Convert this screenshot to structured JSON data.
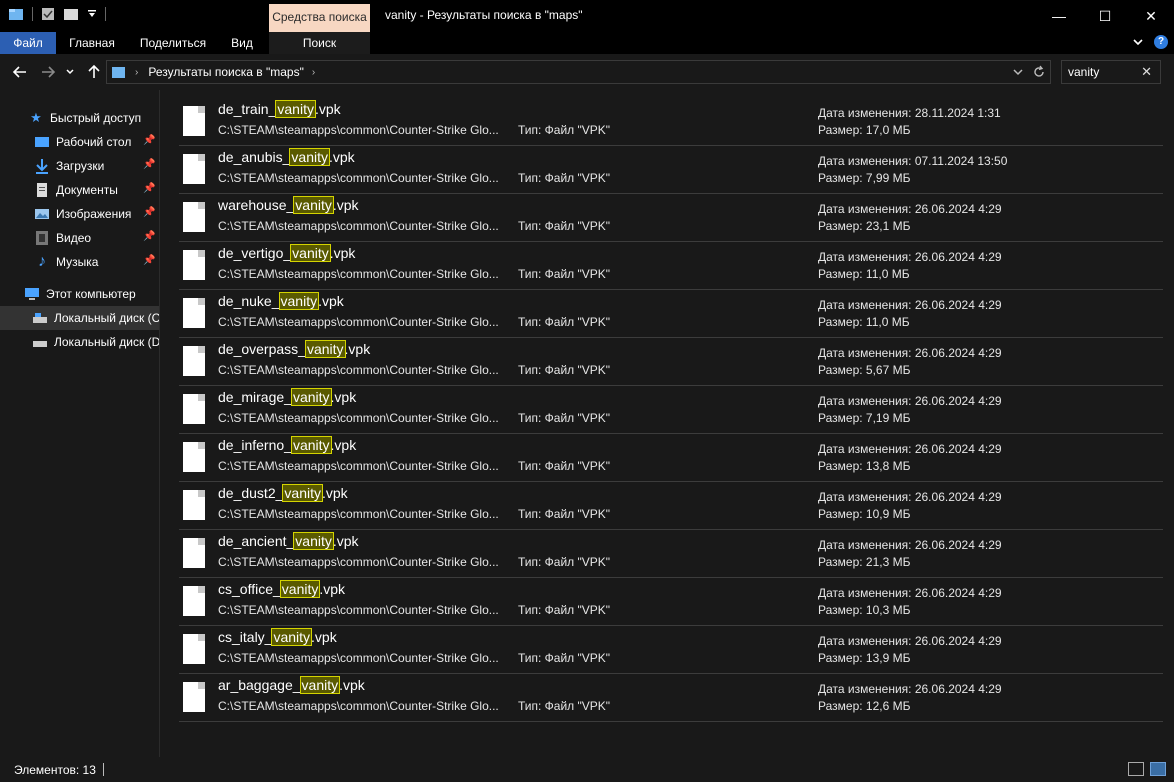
{
  "window": {
    "title": "vanity - Результаты поиска в \"maps\"",
    "tool_tab": "Средства поиска",
    "minimize_glyph": "—",
    "maximize_glyph": "☐",
    "close_glyph": "✕"
  },
  "ribbon": {
    "tabs": [
      "Файл",
      "Главная",
      "Поделиться",
      "Вид",
      "Поиск"
    ]
  },
  "address": {
    "breadcrumb": "Результаты поиска в \"maps\""
  },
  "search": {
    "value": "vanity"
  },
  "sidebar": {
    "quick_access": "Быстрый доступ",
    "items": [
      {
        "label": "Рабочий стол",
        "icon": "desktop-icon"
      },
      {
        "label": "Загрузки",
        "icon": "download-icon"
      },
      {
        "label": "Документы",
        "icon": "documents-icon"
      },
      {
        "label": "Изображения",
        "icon": "pictures-icon"
      },
      {
        "label": "Видео",
        "icon": "video-icon"
      },
      {
        "label": "Музыка",
        "icon": "music-icon"
      }
    ],
    "this_pc": "Этот компьютер",
    "drives": [
      {
        "label": "Локальный диск (C"
      },
      {
        "label": "Локальный диск (D"
      }
    ]
  },
  "results": [
    {
      "prefix": "de_train_",
      "match": "vanity",
      "suffix": ".vpk",
      "path": "C:\\STEAM\\steamapps\\common\\Counter-Strike Glo...",
      "type": "Тип: Файл \"VPK\"",
      "date": "Дата изменения: 28.11.2024 1:31",
      "size": "Размер: 17,0 МБ"
    },
    {
      "prefix": "de_anubis_",
      "match": "vanity",
      "suffix": ".vpk",
      "path": "C:\\STEAM\\steamapps\\common\\Counter-Strike Glo...",
      "type": "Тип: Файл \"VPK\"",
      "date": "Дата изменения: 07.11.2024 13:50",
      "size": "Размер: 7,99 МБ"
    },
    {
      "prefix": "warehouse_",
      "match": "vanity",
      "suffix": ".vpk",
      "path": "C:\\STEAM\\steamapps\\common\\Counter-Strike Glo...",
      "type": "Тип: Файл \"VPK\"",
      "date": "Дата изменения: 26.06.2024 4:29",
      "size": "Размер: 23,1 МБ"
    },
    {
      "prefix": "de_vertigo_",
      "match": "vanity",
      "suffix": ".vpk",
      "path": "C:\\STEAM\\steamapps\\common\\Counter-Strike Glo...",
      "type": "Тип: Файл \"VPK\"",
      "date": "Дата изменения: 26.06.2024 4:29",
      "size": "Размер: 11,0 МБ"
    },
    {
      "prefix": "de_nuke_",
      "match": "vanity",
      "suffix": ".vpk",
      "path": "C:\\STEAM\\steamapps\\common\\Counter-Strike Glo...",
      "type": "Тип: Файл \"VPK\"",
      "date": "Дата изменения: 26.06.2024 4:29",
      "size": "Размер: 11,0 МБ"
    },
    {
      "prefix": "de_overpass_",
      "match": "vanity",
      "suffix": ".vpk",
      "path": "C:\\STEAM\\steamapps\\common\\Counter-Strike Glo...",
      "type": "Тип: Файл \"VPK\"",
      "date": "Дата изменения: 26.06.2024 4:29",
      "size": "Размер: 5,67 МБ"
    },
    {
      "prefix": "de_mirage_",
      "match": "vanity",
      "suffix": ".vpk",
      "path": "C:\\STEAM\\steamapps\\common\\Counter-Strike Glo...",
      "type": "Тип: Файл \"VPK\"",
      "date": "Дата изменения: 26.06.2024 4:29",
      "size": "Размер: 7,19 МБ"
    },
    {
      "prefix": "de_inferno_",
      "match": "vanity",
      "suffix": ".vpk",
      "path": "C:\\STEAM\\steamapps\\common\\Counter-Strike Glo...",
      "type": "Тип: Файл \"VPK\"",
      "date": "Дата изменения: 26.06.2024 4:29",
      "size": "Размер: 13,8 МБ"
    },
    {
      "prefix": "de_dust2_",
      "match": "vanity",
      "suffix": ".vpk",
      "path": "C:\\STEAM\\steamapps\\common\\Counter-Strike Glo...",
      "type": "Тип: Файл \"VPK\"",
      "date": "Дата изменения: 26.06.2024 4:29",
      "size": "Размер: 10,9 МБ"
    },
    {
      "prefix": "de_ancient_",
      "match": "vanity",
      "suffix": ".vpk",
      "path": "C:\\STEAM\\steamapps\\common\\Counter-Strike Glo...",
      "type": "Тип: Файл \"VPK\"",
      "date": "Дата изменения: 26.06.2024 4:29",
      "size": "Размер: 21,3 МБ"
    },
    {
      "prefix": "cs_office_",
      "match": "vanity",
      "suffix": ".vpk",
      "path": "C:\\STEAM\\steamapps\\common\\Counter-Strike Glo...",
      "type": "Тип: Файл \"VPK\"",
      "date": "Дата изменения: 26.06.2024 4:29",
      "size": "Размер: 10,3 МБ"
    },
    {
      "prefix": "cs_italy_",
      "match": "vanity",
      "suffix": ".vpk",
      "path": "C:\\STEAM\\steamapps\\common\\Counter-Strike Glo...",
      "type": "Тип: Файл \"VPK\"",
      "date": "Дата изменения: 26.06.2024 4:29",
      "size": "Размер: 13,9 МБ"
    },
    {
      "prefix": "ar_baggage_",
      "match": "vanity",
      "suffix": ".vpk",
      "path": "C:\\STEAM\\steamapps\\common\\Counter-Strike Glo...",
      "type": "Тип: Файл \"VPK\"",
      "date": "Дата изменения: 26.06.2024 4:29",
      "size": "Размер: 12,6 МБ"
    }
  ],
  "status": {
    "count": "Элементов: 13"
  },
  "colors": {
    "highlight_bg": "#5a5a00",
    "highlight_border": "#d4d400",
    "file_tab_blue": "#2c5fb3",
    "tool_tab_peach": "#f7d7c2"
  }
}
